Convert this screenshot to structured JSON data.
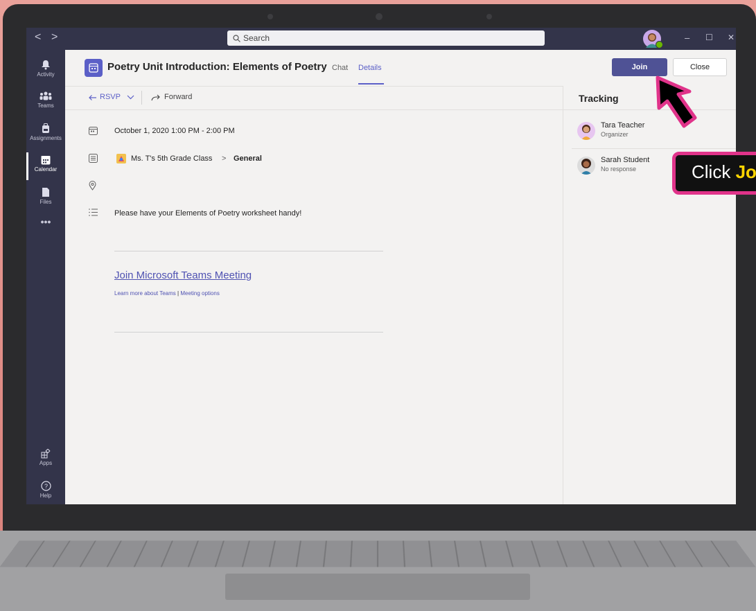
{
  "titlebar": {
    "search_placeholder": "Search",
    "back": "<",
    "forward": ">",
    "minimize": "–",
    "maximize": "☐",
    "close": "✕"
  },
  "rail": {
    "items": [
      {
        "label": "Activity",
        "icon": "bell-icon"
      },
      {
        "label": "Teams",
        "icon": "teams-icon"
      },
      {
        "label": "Assignments",
        "icon": "backpack-icon"
      },
      {
        "label": "Calendar",
        "icon": "calendar-icon",
        "active": true
      },
      {
        "label": "Files",
        "icon": "file-icon"
      },
      {
        "label": "•••",
        "icon": "more-icon"
      }
    ],
    "bottom": [
      {
        "label": "Apps",
        "icon": "apps-icon"
      },
      {
        "label": "Help",
        "icon": "help-icon"
      }
    ]
  },
  "header": {
    "title": "Poetry Unit Introduction: Elements of Poetry",
    "tabs": [
      "Chat",
      "Details"
    ],
    "selected_tab": "Details",
    "join_label": "Join",
    "close_label": "Close"
  },
  "toolbar": {
    "rsvp_label": "RSVP",
    "forward_label": "Forward"
  },
  "details": {
    "datetime": "October 1, 2020 1:00 PM - 2:00 PM",
    "team": "Ms. T's 5th Grade Class",
    "channel_separator": ">",
    "channel": "General",
    "description": "Please have your Elements of Poetry worksheet handy!",
    "join_link": "Join Microsoft Teams Meeting",
    "learn_more": "Learn more about Teams",
    "link_separator": "|",
    "meeting_options": "Meeting options"
  },
  "tracking": {
    "title": "Tracking",
    "people": [
      {
        "name": "Tara Teacher",
        "status": "Organizer"
      },
      {
        "name": "Sarah Student",
        "status": "No response"
      }
    ]
  },
  "annotation": {
    "prefix": "Click ",
    "highlight": "Jo"
  },
  "colors": {
    "accent": "#5b5fc7",
    "join_button": "#4f5295",
    "callout_border": "#e0338a",
    "callout_highlight": "#ffd400"
  }
}
